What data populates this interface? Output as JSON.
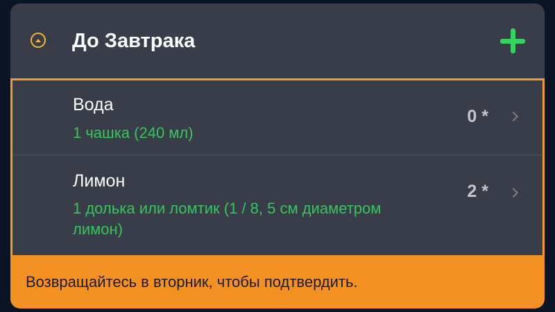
{
  "card": {
    "title": "До Завтрака",
    "title_icon": "sunrise-icon",
    "add_icon": "plus-icon",
    "accent_color": "#f39c25",
    "add_color": "#3ad25e"
  },
  "items": [
    {
      "name": "Вода",
      "portion": "1 чашка (240 мл)",
      "count": "0 *"
    },
    {
      "name": "Лимон",
      "portion": "1 долька или ломтик (1 / 8, 5 см диаметром лимон)",
      "count": "2 *"
    }
  ],
  "footer": {
    "message": "Возвращайтесь в вторник, чтобы подтвердить."
  }
}
